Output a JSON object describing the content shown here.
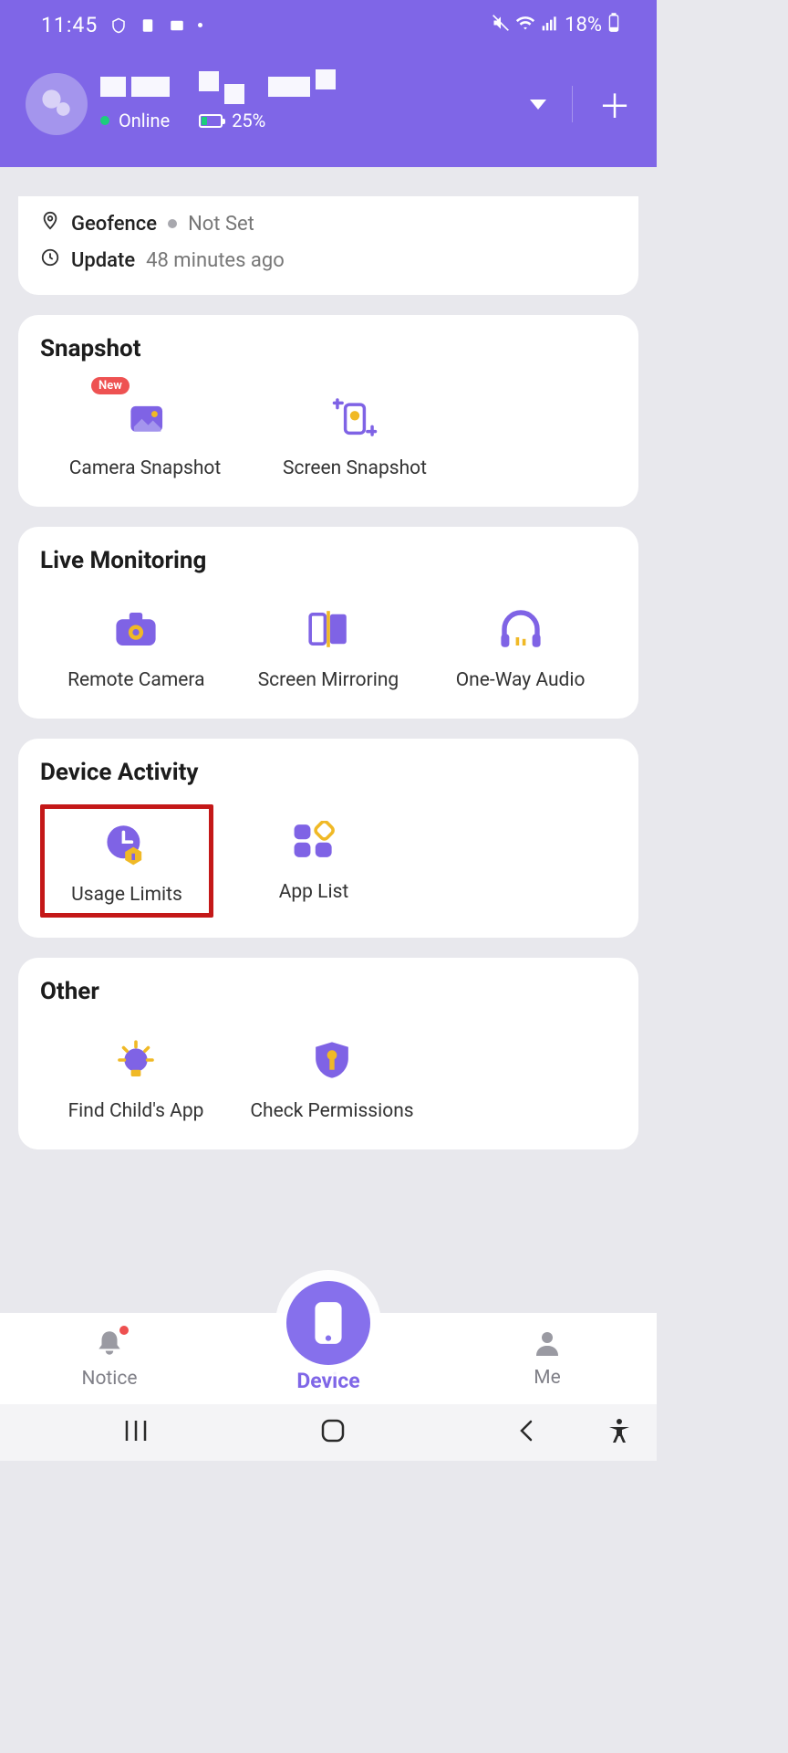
{
  "status": {
    "time": "11:45",
    "battery_pct": "18%"
  },
  "header": {
    "online_label": "Online",
    "battery_pct": "25%"
  },
  "info": {
    "geofence_label": "Geofence",
    "geofence_value": "Not Set",
    "update_label": "Update",
    "update_value": "48 minutes ago"
  },
  "sections": {
    "snapshot": {
      "title": "Snapshot",
      "new_badge": "New",
      "camera_snapshot": "Camera Snapshot",
      "screen_snapshot": "Screen Snapshot"
    },
    "live": {
      "title": "Live Monitoring",
      "remote_camera": "Remote Camera",
      "screen_mirroring": "Screen Mirroring",
      "one_way_audio": "One-Way Audio"
    },
    "device_activity": {
      "title": "Device Activity",
      "usage_limits": "Usage Limits",
      "app_list": "App List"
    },
    "other": {
      "title": "Other",
      "find_child_app": "Find Child's App",
      "check_permissions": "Check Permissions"
    }
  },
  "bottom_nav": {
    "notice": "Notice",
    "device": "Device",
    "me": "Me"
  }
}
